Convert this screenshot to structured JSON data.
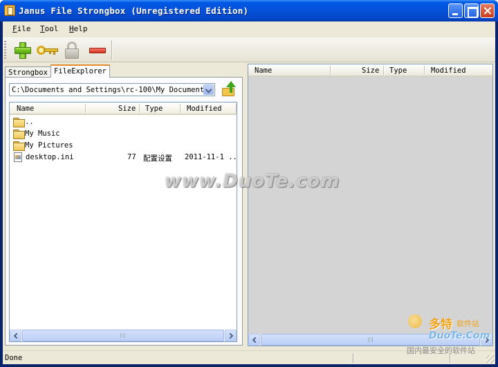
{
  "window": {
    "title": "Janus File Strongbox (Unregistered Edition)"
  },
  "menu": {
    "items": [
      {
        "label": "File",
        "accel": "F",
        "rest": "ile"
      },
      {
        "label": "Tool",
        "accel": "T",
        "rest": "ool"
      },
      {
        "label": "Help",
        "accel": "H",
        "rest": "elp"
      }
    ]
  },
  "toolbar": {
    "buttons": [
      {
        "icon": "add-icon"
      },
      {
        "icon": "key-icon"
      },
      {
        "icon": "lock-icon",
        "disabled": true
      },
      {
        "icon": "remove-icon"
      }
    ]
  },
  "tabs": {
    "strongbox": "Strongbox",
    "file_explorer": "FileExplorer",
    "active": "FileExplorer"
  },
  "explorer": {
    "path": "C:\\Documents and Settings\\rc-100\\My Documents",
    "up_icon": "folder-up-icon",
    "columns": [
      "Name",
      "Size",
      "Type",
      "Modified"
    ],
    "rows": [
      {
        "icon": "folder-icon",
        "name": "..",
        "size": "",
        "type": "",
        "modified": ""
      },
      {
        "icon": "folder-icon",
        "name": "My Music",
        "size": "",
        "type": "",
        "modified": ""
      },
      {
        "icon": "folder-icon",
        "name": "My Pictures",
        "size": "",
        "type": "",
        "modified": ""
      },
      {
        "icon": "ini-file-icon",
        "name": "desktop.ini",
        "size": "77",
        "type": "配置设置",
        "modified": "2011-11-1 .."
      }
    ]
  },
  "strongbox_list": {
    "columns": [
      "Name",
      "Size",
      "Type",
      "Modified"
    ],
    "rows": []
  },
  "status": {
    "text": "Done"
  },
  "watermark": {
    "center": "www.DuoTe.com",
    "logo_main": "多特",
    "logo_sub": "软件站",
    "logo_url": "DuoTe.Com",
    "logo_slogan": "国内最安全的软件站"
  }
}
